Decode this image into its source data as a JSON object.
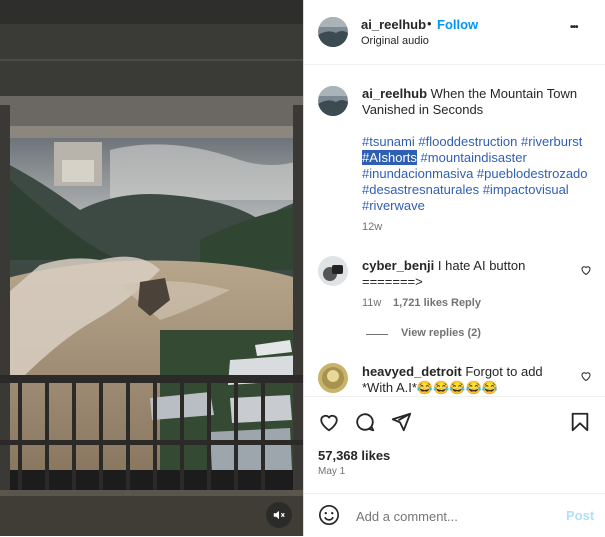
{
  "post": {
    "username": "ai_reelhub",
    "separator": "•",
    "follow_label": "Follow",
    "audio": "Original audio",
    "more_label": "•••"
  },
  "caption": {
    "username": "ai_reelhub",
    "text": "When the Mountain Town Vanished in Seconds",
    "hashtags": [
      "#tsunami",
      "#flooddestruction",
      "#riverburst",
      "#AIshorts",
      "#mountaindisaster",
      "#inundacionmasiva",
      "#pueblodestrozado",
      "#desastresnaturales",
      "#impactovisual",
      "#riverwave"
    ],
    "age": "12w"
  },
  "comments": [
    {
      "username": "cyber_benji",
      "text": "I hate AI button =======>",
      "age": "11w",
      "likes": "1,721 likes",
      "reply_label": "Reply",
      "view_replies": "View replies (2)"
    },
    {
      "username": "heavyed_detroit",
      "text": "Forgot to add *With A.I*😂😂😂😂😂"
    }
  ],
  "stats": {
    "likes": "57,368 likes",
    "date": "May 1"
  },
  "composer": {
    "placeholder": "Add a comment...",
    "post_label": "Post",
    "emoji_icon": "smiley-icon"
  },
  "icons": {
    "like": "heart-icon",
    "comment": "comment-bubble-icon",
    "share": "paper-plane-icon",
    "save": "bookmark-icon",
    "mute": "muted-speaker-icon"
  },
  "colors": {
    "link": "#00376b",
    "follow": "#0095f6",
    "hashtag": "#2f5fb3",
    "post_disabled": "#b2dffc"
  }
}
